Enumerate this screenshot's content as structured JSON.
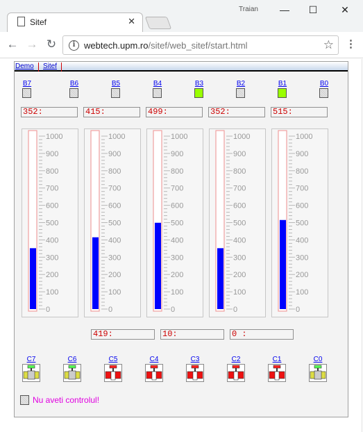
{
  "window": {
    "user": "Traian",
    "minimize": "—",
    "maximize": "☐",
    "close": "✕"
  },
  "tab": {
    "title": "Sitef",
    "close": "✕"
  },
  "toolbar": {
    "back": "←",
    "forward": "→",
    "reload": "↻",
    "url_host": "webtech.upm.ro",
    "url_path": "/sitef/web_sitef/start.html",
    "star": "☆",
    "menu": "⋮",
    "info": "i"
  },
  "nav": {
    "links": [
      "Demo",
      "Sitef"
    ]
  },
  "bits": [
    {
      "label": "B7",
      "on": false
    },
    {
      "label": "B6",
      "on": false
    },
    {
      "label": "B5",
      "on": false
    },
    {
      "label": "B4",
      "on": false
    },
    {
      "label": "B3",
      "on": true
    },
    {
      "label": "B2",
      "on": false
    },
    {
      "label": "B1",
      "on": true
    },
    {
      "label": "B0",
      "on": false
    }
  ],
  "readings": [
    "352:",
    "415:",
    "499:",
    "352:",
    "515:"
  ],
  "gauges": {
    "scale_max": 1000,
    "ticks": [
      "1000",
      "900",
      "800",
      "700",
      "600",
      "500",
      "400",
      "300",
      "200",
      "100",
      "0"
    ],
    "values": [
      352,
      415,
      499,
      352,
      515
    ],
    "fill_color": "#0000ff",
    "tube_color": "#f0a0a0"
  },
  "extra_readings": [
    "419:",
    "10:",
    "0 :"
  ],
  "commands": [
    {
      "label": "C7",
      "state": "off"
    },
    {
      "label": "C6",
      "state": "off"
    },
    {
      "label": "C5",
      "state": "on"
    },
    {
      "label": "C4",
      "state": "on"
    },
    {
      "label": "C3",
      "state": "on"
    },
    {
      "label": "C2",
      "state": "on"
    },
    {
      "label": "C1",
      "state": "on"
    },
    {
      "label": "C0",
      "state": "off"
    }
  ],
  "control": {
    "message": "Nu aveti controlul!"
  }
}
